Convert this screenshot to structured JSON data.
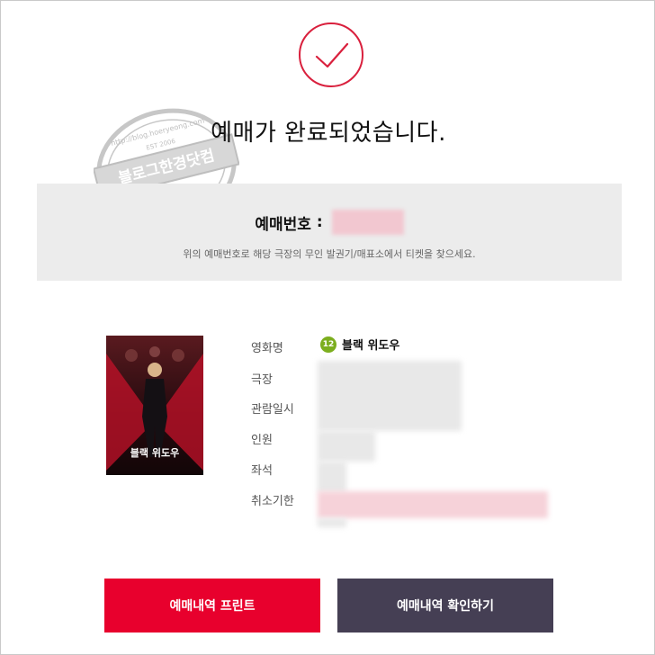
{
  "page": {
    "title": "예매가 완료되었습니다."
  },
  "watermark": {
    "top_text": "http://blog.hoeryeong.com",
    "center_text": "블로그한경닷컴",
    "sub_text": "EST 2006"
  },
  "booking": {
    "label": "예매번호",
    "colon": ":",
    "note": "위의 예매번호로 해당 극장의 무인 발권기/매표소에서 티켓을 찾으세요."
  },
  "poster": {
    "title_text": "블랙 위도우"
  },
  "movie": {
    "age_rating": "12",
    "title": "블랙 위도우"
  },
  "details": {
    "labels": [
      "영화명",
      "극장",
      "관람일시",
      "인원",
      "좌석",
      "취소기한"
    ]
  },
  "buttons": {
    "print": "예매내역 프린트",
    "check": "예매내역 확인하기"
  },
  "colors": {
    "accent_red": "#e8002d",
    "dark_button": "#453f54",
    "check_circle": "#d9203d",
    "age_badge_green": "#7cae1e"
  },
  "icons": {
    "success": "check-circle-icon",
    "watermark": "stamp-icon"
  }
}
